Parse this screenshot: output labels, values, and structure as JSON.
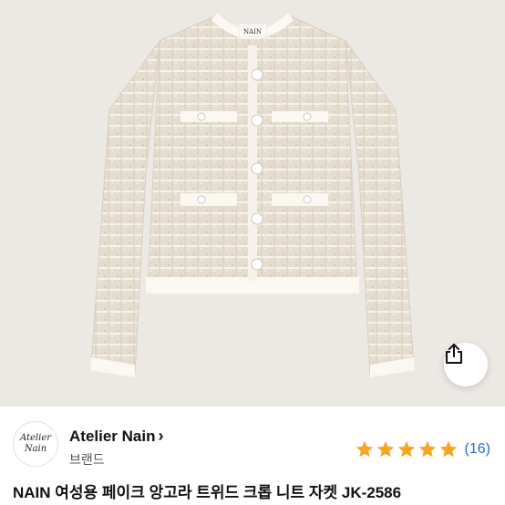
{
  "product_image": {
    "label_tag": "NAIN",
    "alt": "cream tweed cropped knit jacket"
  },
  "share_button": {
    "icon": "share-icon"
  },
  "brand": {
    "logo_line1": "Atelier",
    "logo_line2": "Nain",
    "name": "Atelier Nain",
    "chevron": "›",
    "subtitle": "브랜드"
  },
  "rating": {
    "stars": 5,
    "review_count": "(16)",
    "star_color": "#f5a623"
  },
  "product": {
    "title": "NAIN 여성용 페이크 앙고라 트위드 크롭 니트 자켓 JK-2586"
  },
  "colors": {
    "link": "#2a68d8",
    "background": "#ece8e4"
  }
}
